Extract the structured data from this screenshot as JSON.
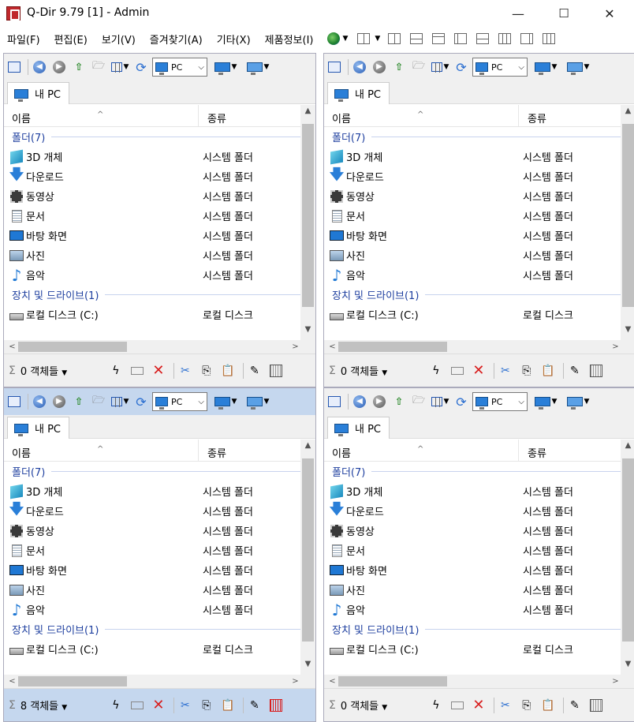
{
  "window": {
    "title": "Q-Dir 9.79 [1] - Admin",
    "minimize": "—",
    "maximize": "☐",
    "close": "✕"
  },
  "menu": [
    "파일(F)",
    "편집(E)",
    "보기(V)",
    "즐겨찾기(A)",
    "기타(X)",
    "제품정보(I)"
  ],
  "colors": {
    "active_bar": "#c5d7ee",
    "group_text": "#1e3f9f",
    "delete_red": "#d81e1e"
  },
  "panes": [
    {
      "path": "PC",
      "tab": "내 PC",
      "status": "0 객체들",
      "active": false,
      "list_offset": 0,
      "list_scroll": {
        "thumb_top": 0.08,
        "thumb_size": 0.78
      }
    },
    {
      "path": "PC",
      "tab": "내 PC",
      "status": "0 객체들",
      "active": false,
      "list_offset": 0,
      "list_scroll": {
        "thumb_top": 0.08,
        "thumb_size": 0.78
      }
    },
    {
      "path": "PC",
      "tab": "내 PC",
      "status": "8 객체들",
      "active": true,
      "list_offset": 0,
      "list_scroll": {
        "thumb_top": 0.08,
        "thumb_size": 0.78
      }
    },
    {
      "path": "PC",
      "tab": "내 PC",
      "status": "0 객체들",
      "active": false,
      "list_offset": 0,
      "list_scroll": {
        "thumb_top": 0.08,
        "thumb_size": 0.78
      }
    }
  ],
  "list": {
    "col_name": "이름",
    "col_type": "종류",
    "groups": [
      {
        "label": "폴더(7)",
        "items": [
          {
            "name": "3D 개체",
            "type": "시스템 폴더",
            "icon": "cube-icon"
          },
          {
            "name": "다운로드",
            "type": "시스템 폴더",
            "icon": "download-arrow-icon"
          },
          {
            "name": "동영상",
            "type": "시스템 폴더",
            "icon": "film-icon"
          },
          {
            "name": "문서",
            "type": "시스템 폴더",
            "icon": "document-icon"
          },
          {
            "name": "바탕 화면",
            "type": "시스템 폴더",
            "icon": "desktop-icon"
          },
          {
            "name": "사진",
            "type": "시스템 폴더",
            "icon": "picture-icon"
          },
          {
            "name": "음악",
            "type": "시스템 폴더",
            "icon": "music-note-icon"
          }
        ]
      },
      {
        "label": "장치 및 드라이브(1)",
        "items": [
          {
            "name": "로컬 디스크 (C:)",
            "type": "로컬 디스크",
            "icon": "disk-drive-icon"
          }
        ]
      }
    ]
  }
}
